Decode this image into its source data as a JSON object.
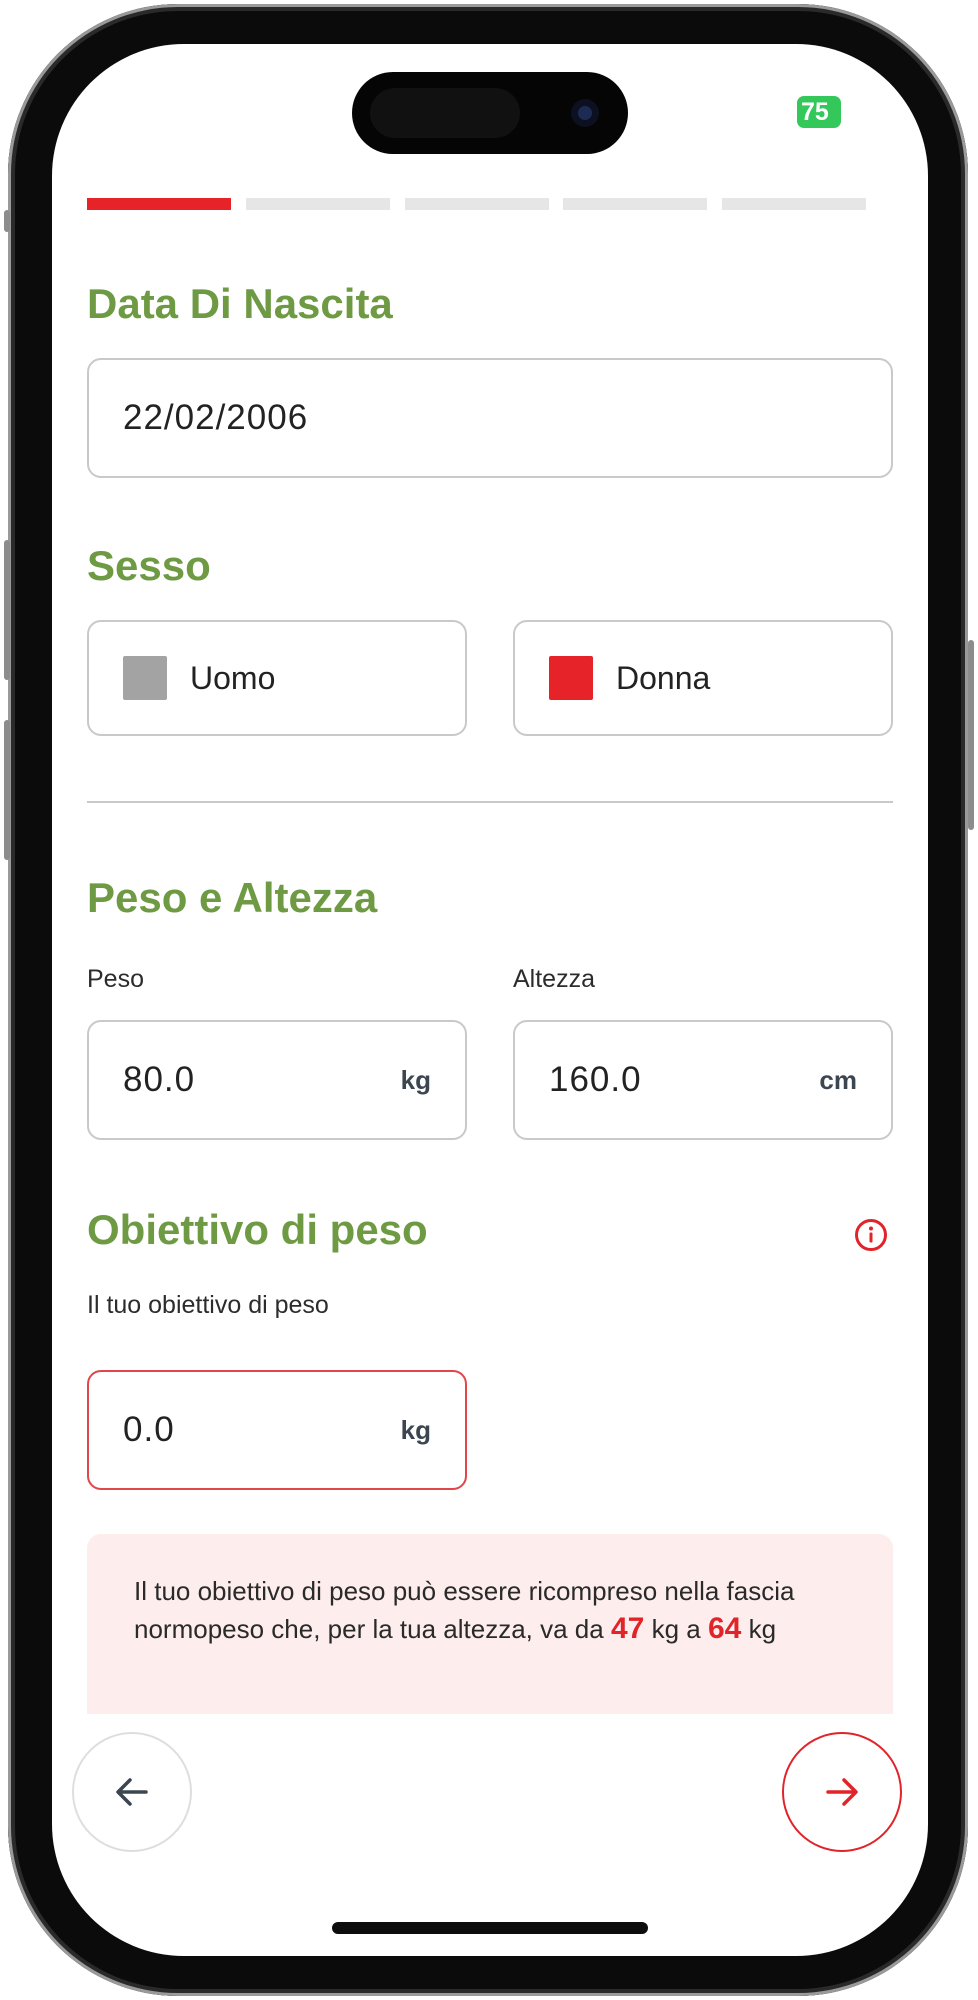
{
  "status_bar": {
    "battery": "75"
  },
  "progress": {
    "total_steps": 5,
    "current_step": 1
  },
  "birth": {
    "title": "Data Di Nascita",
    "value": "22/02/2006"
  },
  "sex": {
    "title": "Sesso",
    "options": [
      {
        "label": "Uomo",
        "selected": false
      },
      {
        "label": "Donna",
        "selected": true
      }
    ]
  },
  "measures": {
    "title": "Peso e Altezza",
    "weight": {
      "label": "Peso",
      "value": "80.0",
      "unit": "kg"
    },
    "height": {
      "label": "Altezza",
      "value": "160.0",
      "unit": "cm"
    }
  },
  "goal": {
    "title": "Obiettivo di peso",
    "label": "Il tuo obiettivo di peso",
    "value": "0.0",
    "unit": "kg",
    "info_icon": "info-circle-icon"
  },
  "notice": {
    "text_line": "Il tuo obiettivo di peso può essere ricompreso nella fascia normopeso che, per la tua altezza, va da",
    "min": "47",
    "mid": "kg a",
    "max": "64",
    "end": "kg"
  },
  "nav": {
    "back_icon": "arrow-left-icon",
    "next_icon": "arrow-right-icon"
  },
  "colors": {
    "accent": "#e52329",
    "heading": "#6f9a44",
    "notice_bg": "#fdeeed",
    "unselected": "#a3a3a3"
  }
}
